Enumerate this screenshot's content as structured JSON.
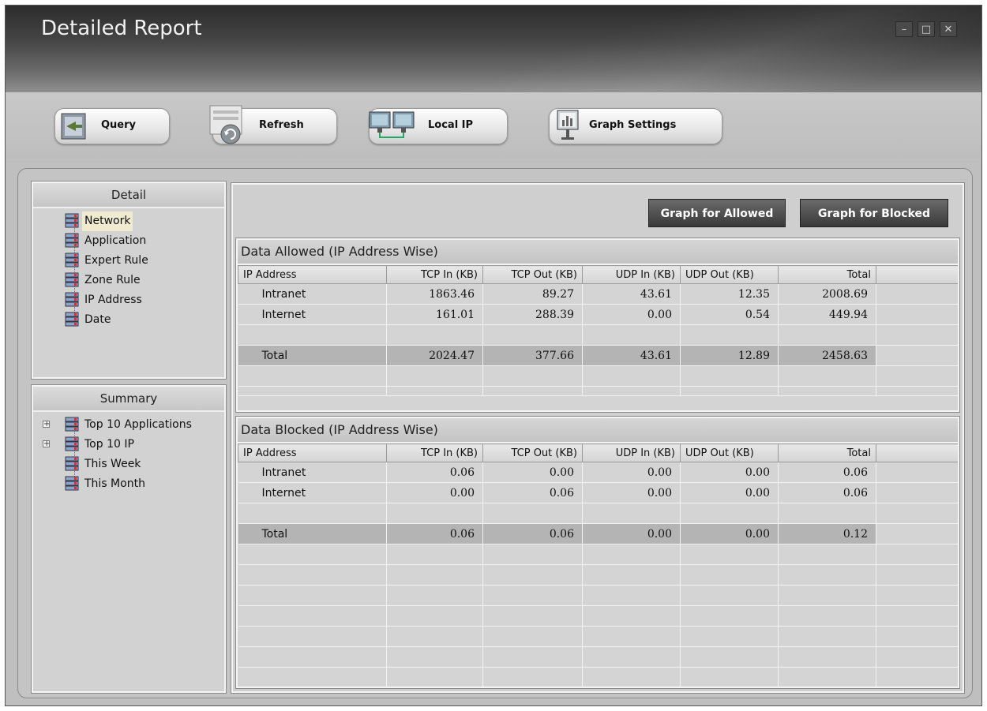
{
  "window": {
    "title": "Detailed Report",
    "controls": {
      "minimize": "–",
      "maximize": "□",
      "close": "✕"
    }
  },
  "toolbar": {
    "query_label": "Query",
    "refresh_label": "Refresh",
    "local_ip_label": "Local IP",
    "graph_settings_label": "Graph Settings"
  },
  "sidebar": {
    "detail": {
      "title": "Detail",
      "items": [
        {
          "label": "Network",
          "selected": true
        },
        {
          "label": "Application"
        },
        {
          "label": "Expert Rule"
        },
        {
          "label": "Zone Rule"
        },
        {
          "label": "IP Address"
        },
        {
          "label": "Date"
        }
      ]
    },
    "summary": {
      "title": "Summary",
      "items": [
        {
          "label": "Top 10 Applications",
          "expandable": true
        },
        {
          "label": "Top 10 IP",
          "expandable": true
        },
        {
          "label": "This Week"
        },
        {
          "label": "This Month"
        }
      ]
    }
  },
  "graph_buttons": {
    "allowed": "Graph for Allowed",
    "blocked": "Graph for Blocked"
  },
  "columns": [
    "IP Address",
    "TCP In (KB)",
    "TCP Out (KB)",
    "UDP In (KB)",
    "UDP Out (KB)",
    "Total"
  ],
  "allowed": {
    "title": "Data Allowed (IP Address Wise)",
    "rows": [
      [
        "Intranet",
        "1863.46",
        "89.27",
        "43.61",
        "12.35",
        "2008.69"
      ],
      [
        "Internet",
        "161.01",
        "288.39",
        "0.00",
        "0.54",
        "449.94"
      ]
    ],
    "total": [
      "Total",
      "2024.47",
      "377.66",
      "43.61",
      "12.89",
      "2458.63"
    ]
  },
  "blocked": {
    "title": "Data Blocked (IP Address Wise)",
    "rows": [
      [
        "Intranet",
        "0.06",
        "0.00",
        "0.00",
        "0.00",
        "0.06"
      ],
      [
        "Internet",
        "0.00",
        "0.06",
        "0.00",
        "0.00",
        "0.06"
      ]
    ],
    "total": [
      "Total",
      "0.06",
      "0.06",
      "0.00",
      "0.00",
      "0.12"
    ]
  }
}
